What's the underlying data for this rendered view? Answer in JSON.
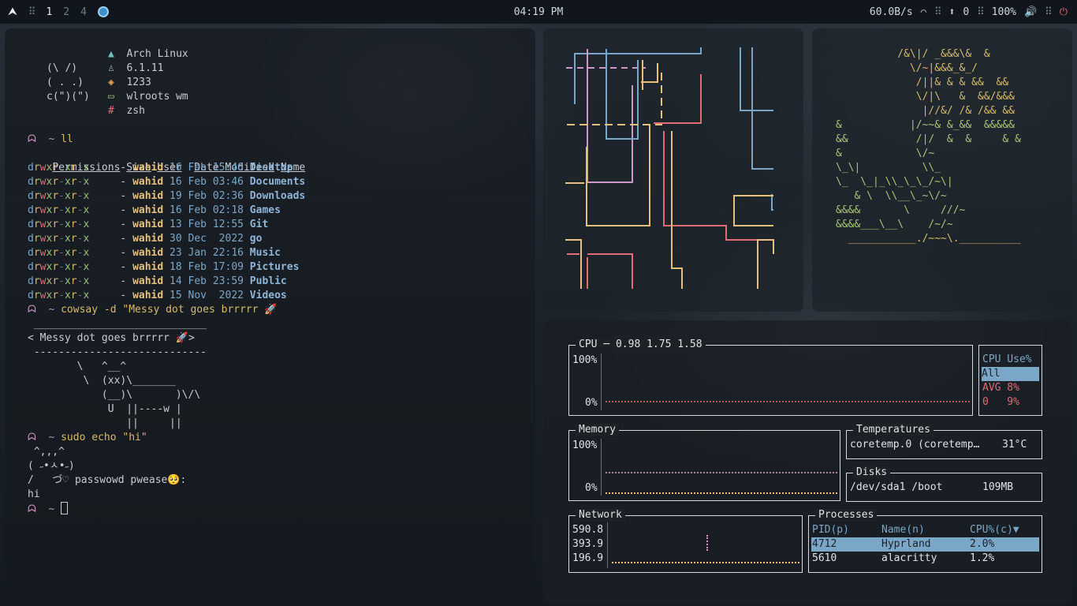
{
  "topbar": {
    "workspaces": [
      "1",
      "2",
      "4"
    ],
    "active_workspace": "1",
    "clock": "04:19 PM",
    "net_speed": "60.0B/s",
    "updates": "0",
    "volume": "100%"
  },
  "terminal": {
    "fetch": {
      "art": [
        "(\\ /)",
        "( . .)",
        "c(\")(\")"
      ],
      "os": "Arch Linux",
      "kernel": "6.1.11",
      "packages": "1233",
      "wm": "wlroots wm",
      "shell": "zsh"
    },
    "prompt": "~",
    "cmd1": "ll",
    "ls_headers": [
      "Permissions",
      "Size",
      "User",
      "Date Modified",
      "Name"
    ],
    "ls_rows": [
      {
        "size": "-",
        "user": "wahid",
        "date": "16 Feb 15:46",
        "name": "Desktop"
      },
      {
        "size": "-",
        "user": "wahid",
        "date": "16 Feb 03:46",
        "name": "Documents"
      },
      {
        "size": "-",
        "user": "wahid",
        "date": "19 Feb 02:36",
        "name": "Downloads"
      },
      {
        "size": "-",
        "user": "wahid",
        "date": "16 Feb 02:18",
        "name": "Games"
      },
      {
        "size": "-",
        "user": "wahid",
        "date": "13 Feb 12:55",
        "name": "Git"
      },
      {
        "size": "-",
        "user": "wahid",
        "date": "30 Dec  2022",
        "name": "go"
      },
      {
        "size": "-",
        "user": "wahid",
        "date": "23 Jan 22:16",
        "name": "Music"
      },
      {
        "size": "-",
        "user": "wahid",
        "date": "18 Feb 17:09",
        "name": "Pictures"
      },
      {
        "size": "-",
        "user": "wahid",
        "date": "14 Feb 23:59",
        "name": "Public"
      },
      {
        "size": "-",
        "user": "wahid",
        "date": "15 Nov  2022",
        "name": "Videos"
      }
    ],
    "cmd2_prefix": "cowsay -d ",
    "cmd2_string": "\"Messy dot goes brrrrr 🚀",
    "cowsay": [
      " ____________________________",
      "< Messy dot goes brrrrr 🚀>",
      " ----------------------------",
      "        \\   ^__^",
      "         \\  (xx)\\_______",
      "            (__)\\       )\\/\\",
      "             U  ||----w |",
      "                ||     ||"
    ],
    "cmd3_prefix": "sudo echo ",
    "cmd3_string": "\"hi\"",
    "sudo_art": [
      " ^,,,^",
      "( ˶•ㅅ•˶)",
      "/   づ♡ passwowd pwease🥺:"
    ],
    "output": "hi"
  },
  "ascii_art": [
    "          /&\\|/ _&&&\\&  &",
    "            \\/~|&&&_&_/",
    "             /||& & & &&  &&",
    "             \\/|\\   &  &&/&&&",
    "              |//&/ /& /&& &&",
    "&           |/~~& &_&&  &&&&&",
    "&&           /|/  &  &     & &",
    "&            \\/~",
    "\\_\\|          \\\\_",
    "\\_  \\_|_\\\\_\\_\\_/~\\|",
    "   & \\  \\\\__\\_~\\/~",
    "&&&&       \\     ///~",
    "&&&&___\\__\\    /~/~",
    "  ___________./~~~\\.__________"
  ],
  "btop": {
    "cpu": {
      "title": "CPU",
      "load": "0.98 1.75 1.58",
      "max": "100%",
      "min": "0%",
      "side_title": "CPU Use%",
      "side_all": "All",
      "side_avg": "AVG 8%",
      "side_core": "0   9%"
    },
    "memory": {
      "title": "Memory",
      "max": "100%",
      "min": "0%"
    },
    "temps": {
      "title": "Temperatures",
      "sensor": "coretemp.0 (coretemp…",
      "value": "31°C"
    },
    "disks": {
      "title": "Disks",
      "mount": "/dev/sda1 /boot",
      "size": "109MB"
    },
    "network": {
      "title": "Network",
      "levels": [
        "590.8",
        "393.9",
        "196.9"
      ]
    },
    "processes": {
      "title": "Processes",
      "headers": [
        "PID(p)",
        "Name(n)",
        "CPU%(c)▼"
      ],
      "rows": [
        {
          "pid": "4712",
          "name": "Hyprland",
          "cpu": "2.0%"
        },
        {
          "pid": "5610",
          "name": "alacritty",
          "cpu": "1.2%"
        }
      ]
    }
  },
  "colors": {
    "accent_blue": "#7aa6c8",
    "accent_yellow": "#d8b96a",
    "accent_red": "#e06c75",
    "accent_green": "#98c379",
    "accent_pink": "#d197c9"
  }
}
